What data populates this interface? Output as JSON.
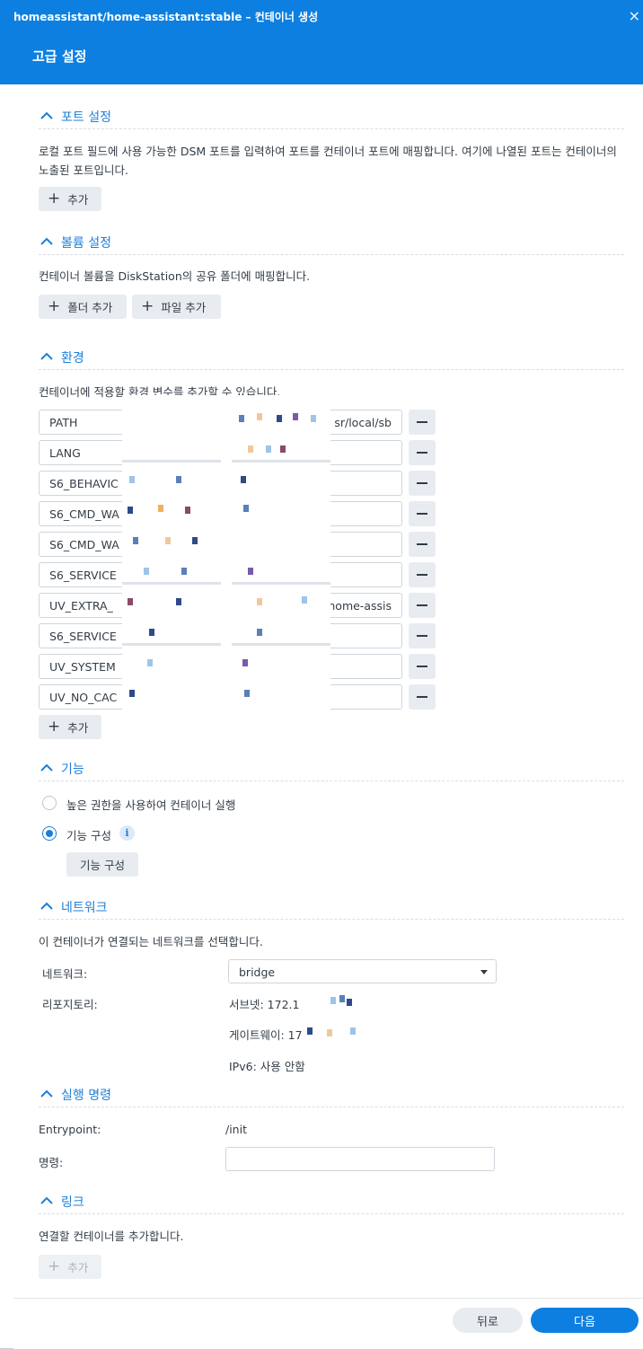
{
  "window": {
    "title": "homeassistant/home-assistant:stable – 컨테이너 생성",
    "close": "×"
  },
  "dialog": {
    "title": "고급 설정"
  },
  "ports": {
    "title": "포트 설정",
    "description": "로컬 포트 필드에 사용 가능한 DSM 포트를 입력하여 포트를 컨테이너 포트에 매핑합니다. 여기에 나열된 포트는 컨테이너의 노출된 포트입니다.",
    "add_label": "추가"
  },
  "volumes": {
    "title": "볼륨 설정",
    "description": "컨테이너 볼륨을 DiskStation의 공유 폴더에 매핑합니다.",
    "add_folder_label": "폴더 추가",
    "add_file_label": "파일 추가"
  },
  "environment": {
    "title": "환경",
    "description": "컨테이너에 적용할 환경 변수를 추가할 수 있습니다.",
    "add_label": "추가",
    "rows": [
      {
        "key": "PATH",
        "value": "sr/local/sb"
      },
      {
        "key": "LANG",
        "value": ""
      },
      {
        "key": "S6_BEHAVIC",
        "value": ""
      },
      {
        "key": "S6_CMD_WA",
        "value": ""
      },
      {
        "key": "S6_CMD_WA",
        "value": ""
      },
      {
        "key": "S6_SERVICE",
        "value": ""
      },
      {
        "key": "UV_EXTRA_",
        "value": "home-assis"
      },
      {
        "key": "S6_SERVICE",
        "value": ""
      },
      {
        "key": "UV_SYSTEM",
        "value": ""
      },
      {
        "key": "UV_NO_CAC",
        "value": ""
      }
    ]
  },
  "capabilities": {
    "title": "기능",
    "option_privileged": "높은 권한을 사용하여 컨테이너 실행",
    "option_configure": "기능 구성",
    "selected": "option_configure",
    "configure_button": "기능 구성",
    "info": "i"
  },
  "network": {
    "title": "네트워크",
    "description": "이 컨테이너가 연결되는 네트워크를 선택합니다.",
    "network_label": "네트워크:",
    "network_value": "bridge",
    "repository_label": "리포지토리:",
    "subnet": "서브넷: 172.1",
    "gateway": "게이트웨이: 17",
    "ipv6": "IPv6: 사용 안함"
  },
  "execution": {
    "title": "실행 명령",
    "entrypoint_label": "Entrypoint:",
    "entrypoint_value": "/init",
    "command_label": "명령:",
    "command_value": ""
  },
  "links": {
    "title": "링크",
    "description": "연결할 컨테이너를 추가합니다.",
    "add_label": "추가"
  },
  "footer": {
    "back_label": "뒤로",
    "next_label": "다음"
  },
  "colors": {
    "accent": "#0d7fe1",
    "section_title": "#1e7fd7",
    "text": "#333c46",
    "button_bg": "#e8ecf1"
  },
  "icons": {
    "section_toggle": "chevron-up-icon",
    "add": "plus-icon",
    "remove": "minus-icon",
    "dropdown": "caret-down-icon",
    "close": "close-icon"
  }
}
